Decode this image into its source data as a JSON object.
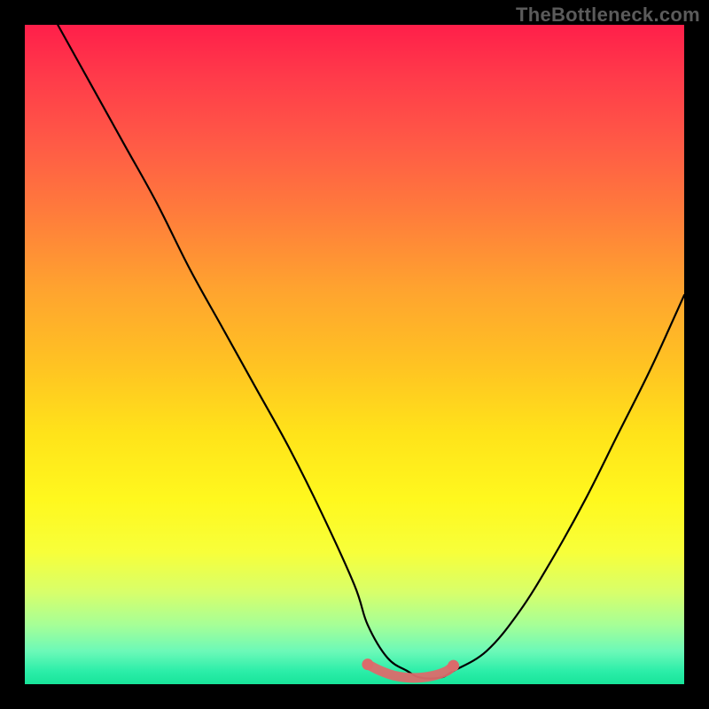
{
  "watermark": {
    "text": "TheBottleneck.com"
  },
  "chart_data": {
    "type": "line",
    "title": "",
    "xlabel": "",
    "ylabel": "",
    "xlim": [
      0,
      100
    ],
    "ylim": [
      0,
      100
    ],
    "grid": false,
    "legend": null,
    "annotations": [],
    "series": [
      {
        "name": "bottleneck-curve",
        "color": "#000000",
        "x": [
          5,
          10,
          15,
          20,
          25,
          30,
          35,
          40,
          45,
          50,
          52,
          55,
          58,
          60,
          63,
          65,
          70,
          75,
          80,
          85,
          90,
          95,
          100
        ],
        "y": [
          100,
          91,
          82,
          73,
          63,
          54,
          45,
          36,
          26,
          15,
          9,
          4,
          2,
          1,
          1,
          2,
          5,
          11,
          19,
          28,
          38,
          48,
          59
        ]
      },
      {
        "name": "optimal-zone",
        "color": "#e06666",
        "x": [
          52,
          54,
          56,
          58,
          60,
          62,
          64,
          65
        ],
        "y": [
          3.0,
          2.0,
          1.3,
          1.0,
          1.0,
          1.3,
          2.0,
          2.8
        ]
      }
    ]
  }
}
